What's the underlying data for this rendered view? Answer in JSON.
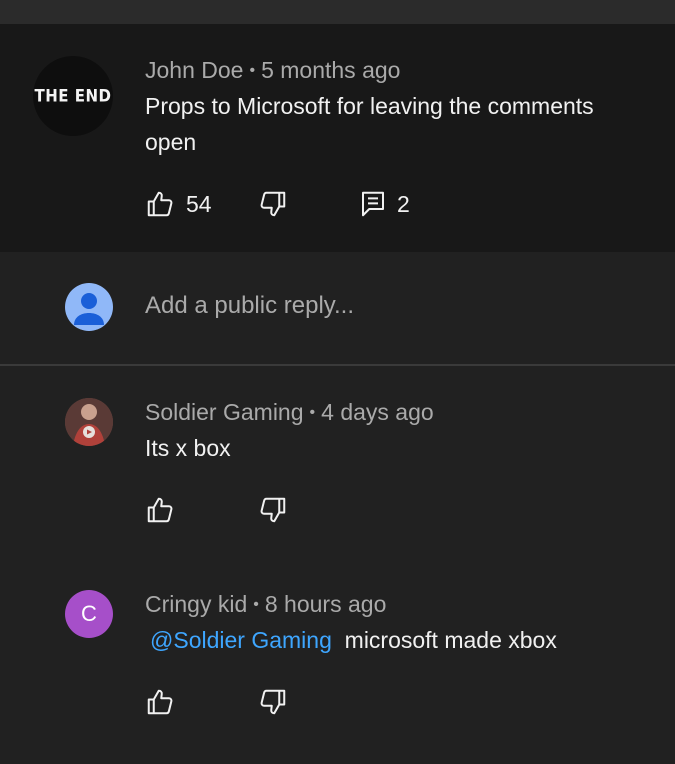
{
  "main_comment": {
    "avatar_text": "THE END",
    "author": "John Doe",
    "time": "5 months ago",
    "text_line1": "Props to Microsoft for leaving the comments",
    "text_line2": "open",
    "likes": "54",
    "reply_count": "2"
  },
  "reply_input": {
    "placeholder": "Add a public reply..."
  },
  "replies": [
    {
      "author": "Soldier Gaming",
      "time": "4 days ago",
      "text": "Its x box"
    },
    {
      "avatar_letter": "C",
      "author": "Cringy kid",
      "time": "8 hours ago",
      "mention": "@Soldier Gaming",
      "text": "microsoft made xbox"
    }
  ],
  "colors": {
    "background": "#212121",
    "highlight": "#181818",
    "mention": "#3ea6ff",
    "avatar_c": "#a64fc9"
  }
}
